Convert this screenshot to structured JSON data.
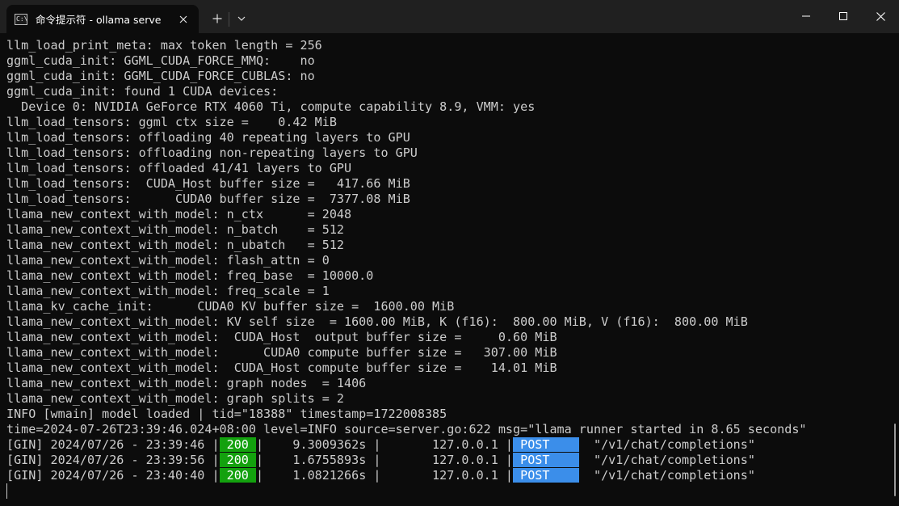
{
  "window": {
    "tab_title": "命令提示符 - ollama  serve",
    "tab_icon_text": "C:\\",
    "icons": {
      "tab": "command-prompt-icon",
      "tab_close": "close-icon",
      "new_tab": "plus-icon",
      "dropdown": "chevron-down-icon",
      "minimize": "minimize-icon",
      "maximize": "maximize-icon",
      "close": "close-icon"
    }
  },
  "terminal": {
    "colors": {
      "background": "#0c0c0c",
      "text": "#cccccc",
      "status_200": "#13a10e",
      "method_post": "#3b8eea"
    },
    "log_lines": [
      "llm_load_print_meta: max token length = 256",
      "ggml_cuda_init: GGML_CUDA_FORCE_MMQ:    no",
      "ggml_cuda_init: GGML_CUDA_FORCE_CUBLAS: no",
      "ggml_cuda_init: found 1 CUDA devices:",
      "  Device 0: NVIDIA GeForce RTX 4060 Ti, compute capability 8.9, VMM: yes",
      "llm_load_tensors: ggml ctx size =    0.42 MiB",
      "llm_load_tensors: offloading 40 repeating layers to GPU",
      "llm_load_tensors: offloading non-repeating layers to GPU",
      "llm_load_tensors: offloaded 41/41 layers to GPU",
      "llm_load_tensors:  CUDA_Host buffer size =   417.66 MiB",
      "llm_load_tensors:      CUDA0 buffer size =  7377.08 MiB",
      "llama_new_context_with_model: n_ctx      = 2048",
      "llama_new_context_with_model: n_batch    = 512",
      "llama_new_context_with_model: n_ubatch   = 512",
      "llama_new_context_with_model: flash_attn = 0",
      "llama_new_context_with_model: freq_base  = 10000.0",
      "llama_new_context_with_model: freq_scale = 1",
      "llama_kv_cache_init:      CUDA0 KV buffer size =  1600.00 MiB",
      "llama_new_context_with_model: KV self size  = 1600.00 MiB, K (f16):  800.00 MiB, V (f16):  800.00 MiB",
      "llama_new_context_with_model:  CUDA_Host  output buffer size =     0.60 MiB",
      "llama_new_context_with_model:      CUDA0 compute buffer size =   307.00 MiB",
      "llama_new_context_with_model:  CUDA_Host compute buffer size =    14.01 MiB",
      "llama_new_context_with_model: graph nodes  = 1406",
      "llama_new_context_with_model: graph splits = 2",
      "INFO [wmain] model loaded | tid=\"18388\" timestamp=1722008385",
      "time=2024-07-26T23:39:46.024+08:00 level=INFO source=server.go:622 msg=\"llama runner started in 8.65 seconds\""
    ],
    "gin_requests": [
      {
        "prefix": "[GIN] 2024/07/26 - 23:39:46 |",
        "status": " 200 ",
        "latency": "|    9.3009362s |       127.0.0.1 |",
        "method": " POST    ",
        "path": "  \"/v1/chat/completions\""
      },
      {
        "prefix": "[GIN] 2024/07/26 - 23:39:56 |",
        "status": " 200 ",
        "latency": "|    1.6755893s |       127.0.0.1 |",
        "method": " POST    ",
        "path": "  \"/v1/chat/completions\""
      },
      {
        "prefix": "[GIN] 2024/07/26 - 23:40:40 |",
        "status": " 200 ",
        "latency": "|    1.0821266s |       127.0.0.1 |",
        "method": " POST    ",
        "path": "  \"/v1/chat/completions\""
      }
    ]
  }
}
